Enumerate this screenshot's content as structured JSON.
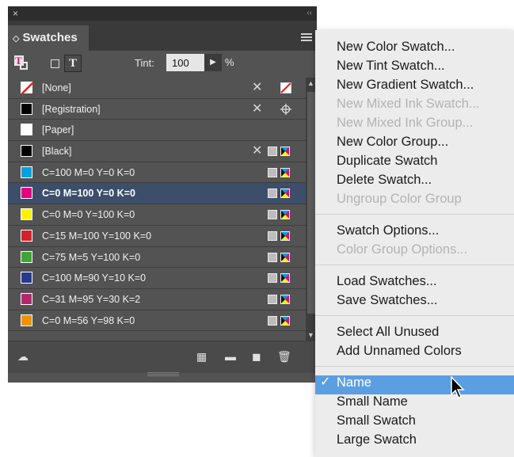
{
  "panel": {
    "title_close": "×",
    "title_collapse": "‹‹",
    "tab_label": "Swatches",
    "tint_label": "Tint:",
    "tint_value": "100",
    "tint_percent": "%"
  },
  "swatches": [
    {
      "name": "[None]",
      "color": "none",
      "cmyk": false
    },
    {
      "name": "[Registration]",
      "color": "#000000",
      "cmyk": false
    },
    {
      "name": "[Paper]",
      "color": "#ffffff",
      "cmyk": false
    },
    {
      "name": "[Black]",
      "color": "#000000",
      "cmyk": true
    },
    {
      "name": "C=100 M=0 Y=0 K=0",
      "color": "#00a0e3",
      "cmyk": true
    },
    {
      "name": "C=0 M=100 Y=0 K=0",
      "color": "#e5007e",
      "cmyk": true,
      "selected": true
    },
    {
      "name": "C=0 M=0 Y=100 K=0",
      "color": "#fff200",
      "cmyk": true
    },
    {
      "name": "C=15 M=100 Y=100 K=0",
      "color": "#d2222a",
      "cmyk": true
    },
    {
      "name": "C=75 M=5 Y=100 K=0",
      "color": "#3fa535",
      "cmyk": true
    },
    {
      "name": "C=100 M=90 Y=10 K=0",
      "color": "#253a8e",
      "cmyk": true
    },
    {
      "name": "C=31 M=95 Y=30 K=2",
      "color": "#b0286e",
      "cmyk": true
    },
    {
      "name": "C=0 M=56 Y=98 K=0",
      "color": "#f39200",
      "cmyk": true
    }
  ],
  "menu": {
    "groups": [
      [
        {
          "label": "New Color Swatch...",
          "enabled": true
        },
        {
          "label": "New Tint Swatch...",
          "enabled": true
        },
        {
          "label": "New Gradient Swatch...",
          "enabled": true
        },
        {
          "label": "New Mixed Ink Swatch...",
          "enabled": false
        },
        {
          "label": "New Mixed Ink Group...",
          "enabled": false
        },
        {
          "label": "New Color Group...",
          "enabled": true
        },
        {
          "label": "Duplicate Swatch",
          "enabled": true
        },
        {
          "label": "Delete Swatch...",
          "enabled": true
        },
        {
          "label": "Ungroup Color Group",
          "enabled": false
        }
      ],
      [
        {
          "label": "Swatch Options...",
          "enabled": true
        },
        {
          "label": "Color Group Options...",
          "enabled": false
        }
      ],
      [
        {
          "label": "Load Swatches...",
          "enabled": true
        },
        {
          "label": "Save Swatches...",
          "enabled": true
        }
      ],
      [
        {
          "label": "Select All Unused",
          "enabled": true
        },
        {
          "label": "Add Unnamed Colors",
          "enabled": true
        }
      ],
      [
        {
          "label": "Name",
          "enabled": true,
          "checked": true,
          "highlighted": true
        },
        {
          "label": "Small Name",
          "enabled": true
        },
        {
          "label": "Small Swatch",
          "enabled": true
        },
        {
          "label": "Large Swatch",
          "enabled": true
        }
      ]
    ]
  }
}
